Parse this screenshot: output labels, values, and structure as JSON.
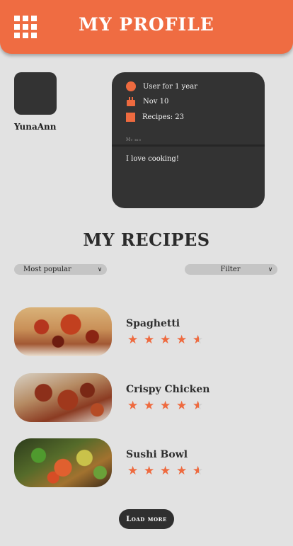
{
  "header": {
    "title": "MY PROFILE",
    "menu_icon": "grid-menu-icon"
  },
  "profile": {
    "username": "YunaAnn",
    "stats": [
      {
        "icon": "user-dot-icon",
        "text": "User for 1 year"
      },
      {
        "icon": "cake-icon",
        "text": "Nov 10"
      },
      {
        "icon": "recipes-square-icon",
        "text": "Recipes: 23"
      }
    ],
    "bio_label": "My bio",
    "bio_text": "I love cooking!"
  },
  "recipes_section": {
    "title": "MY RECIPES",
    "sort": {
      "selected": "Most popular"
    },
    "filter": {
      "selected": "Filter"
    },
    "items": [
      {
        "name": "Spaghetti",
        "rating": 4.5
      },
      {
        "name": "Crispy Chicken",
        "rating": 4.5
      },
      {
        "name": "Sushi Bowl",
        "rating": 4.5
      }
    ],
    "load_more": "Load more"
  },
  "colors": {
    "accent": "#ef6c42",
    "background": "#e2e2e2",
    "card": "#333333",
    "text_dark": "#2c2c2c",
    "star_empty": "#cfcfcf"
  }
}
